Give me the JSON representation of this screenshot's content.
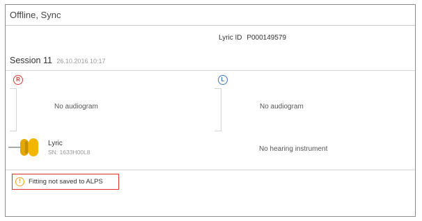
{
  "header": {
    "title": "Offline, Sync"
  },
  "lyric_id": {
    "label": "Lyric ID",
    "value": "P000149579"
  },
  "session": {
    "name": "Session 11",
    "date": "26.10.2016 10:17"
  },
  "ears": {
    "right": {
      "badge": "R",
      "audiogram": "No audiogram",
      "color": "#d23c3c"
    },
    "left": {
      "badge": "L",
      "audiogram": "No audiogram",
      "color": "#3a7bd5"
    }
  },
  "devices": {
    "right": {
      "name": "Lyric",
      "serial": "SN: 1633H00L8",
      "icon": "hearing-instrument-icon"
    },
    "left": {
      "status": "No hearing instrument"
    }
  },
  "warning": {
    "text": "Fitting not saved to ALPS",
    "icon": "warning-icon",
    "border_color": "#e03030"
  }
}
